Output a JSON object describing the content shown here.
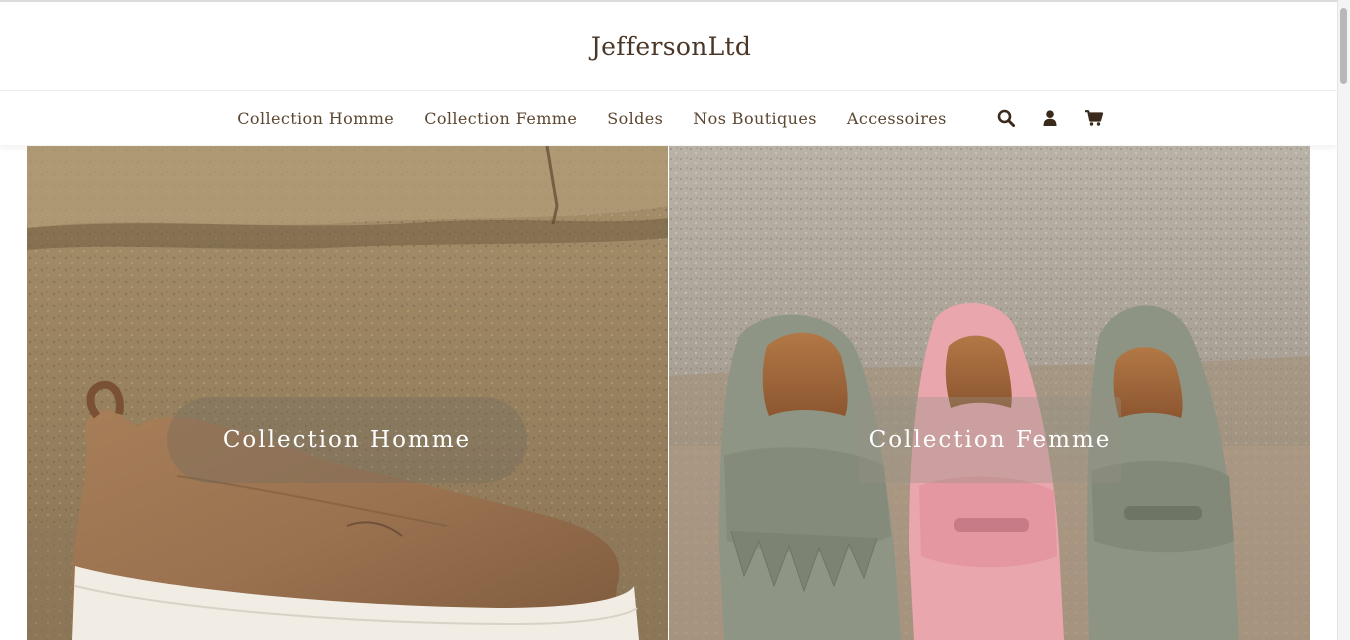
{
  "site": {
    "logo": "JeffersonLtd"
  },
  "nav": {
    "items": [
      "Collection Homme",
      "Collection Femme",
      "Soldes",
      "Nos Boutiques",
      "Accessoires"
    ],
    "icons": [
      "search-icon",
      "user-icon",
      "cart-icon"
    ]
  },
  "hero": {
    "left": {
      "label": "Collection Homme"
    },
    "right": {
      "label": "Collection Femme"
    }
  },
  "colors": {
    "text": "#5b4631",
    "logo": "#4b3626",
    "background": "#ffffff"
  }
}
